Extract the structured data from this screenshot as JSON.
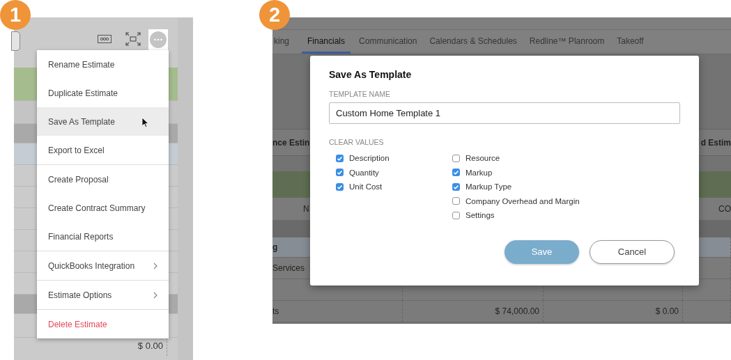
{
  "step_1": {
    "badge": "1",
    "amount": "$ 0.00",
    "menu": [
      [
        {
          "label": "Rename Estimate",
          "selected": false,
          "submenu": false,
          "kind": "normal"
        },
        {
          "label": "Duplicate Estimate",
          "selected": false,
          "submenu": false,
          "kind": "normal"
        },
        {
          "label": "Save As Template",
          "selected": true,
          "submenu": false,
          "kind": "normal"
        },
        {
          "label": "Export to Excel",
          "selected": false,
          "submenu": false,
          "kind": "normal"
        }
      ],
      [
        {
          "label": "Create Proposal",
          "selected": false,
          "submenu": false,
          "kind": "normal"
        },
        {
          "label": "Create Contract Summary",
          "selected": false,
          "submenu": false,
          "kind": "normal"
        },
        {
          "label": "Financial Reports",
          "selected": false,
          "submenu": false,
          "kind": "normal"
        }
      ],
      [
        {
          "label": "QuickBooks Integration",
          "selected": false,
          "submenu": true,
          "kind": "normal"
        }
      ],
      [
        {
          "label": "Estimate Options",
          "selected": false,
          "submenu": true,
          "kind": "normal"
        }
      ],
      [
        {
          "label": "Delete Estimate",
          "selected": false,
          "submenu": false,
          "kind": "danger"
        }
      ]
    ]
  },
  "step_2": {
    "badge": "2",
    "tabs": [
      {
        "label": "king",
        "selected": false
      },
      {
        "label": "Financials",
        "selected": true
      },
      {
        "label": "Communication",
        "selected": false
      },
      {
        "label": "Calendars & Schedules",
        "selected": false
      },
      {
        "label": "Redline™ Planroom",
        "selected": false
      },
      {
        "label": "Takeoff",
        "selected": false
      }
    ],
    "table": {
      "header_left": "nce Estin",
      "header_right": "d Estim",
      "subheader_left": "N",
      "subheader_right": "CO",
      "rows": [
        {
          "column_1": "g",
          "column_2": "",
          "column_3": ""
        },
        {
          "column_1": "Services",
          "column_2": "",
          "column_3": ""
        },
        {
          "column_1": "",
          "column_2": "",
          "column_3": ""
        },
        {
          "column_1": "ts",
          "column_2": "$ 74,000.00",
          "column_3": "$ 0.00"
        }
      ]
    },
    "dialog": {
      "title": "Save As Template",
      "name_label": "TEMPLATE NAME",
      "name_value": "Custom Home Template 1",
      "clear_label": "CLEAR VALUES",
      "columns": [
        [
          {
            "label": "Description",
            "checked": true
          },
          {
            "label": "Quantity",
            "checked": true
          },
          {
            "label": "Unit Cost",
            "checked": true
          }
        ],
        [
          {
            "label": "Resource",
            "checked": false
          },
          {
            "label": "Markup",
            "checked": true
          },
          {
            "label": "Markup Type",
            "checked": true
          },
          {
            "label": "Company Overhead and Margin",
            "checked": false
          },
          {
            "label": "Settings",
            "checked": false
          }
        ]
      ],
      "buttons": [
        {
          "label": "Save",
          "kind": "primary"
        },
        {
          "label": "Cancel",
          "kind": "secondary"
        }
      ]
    }
  }
}
